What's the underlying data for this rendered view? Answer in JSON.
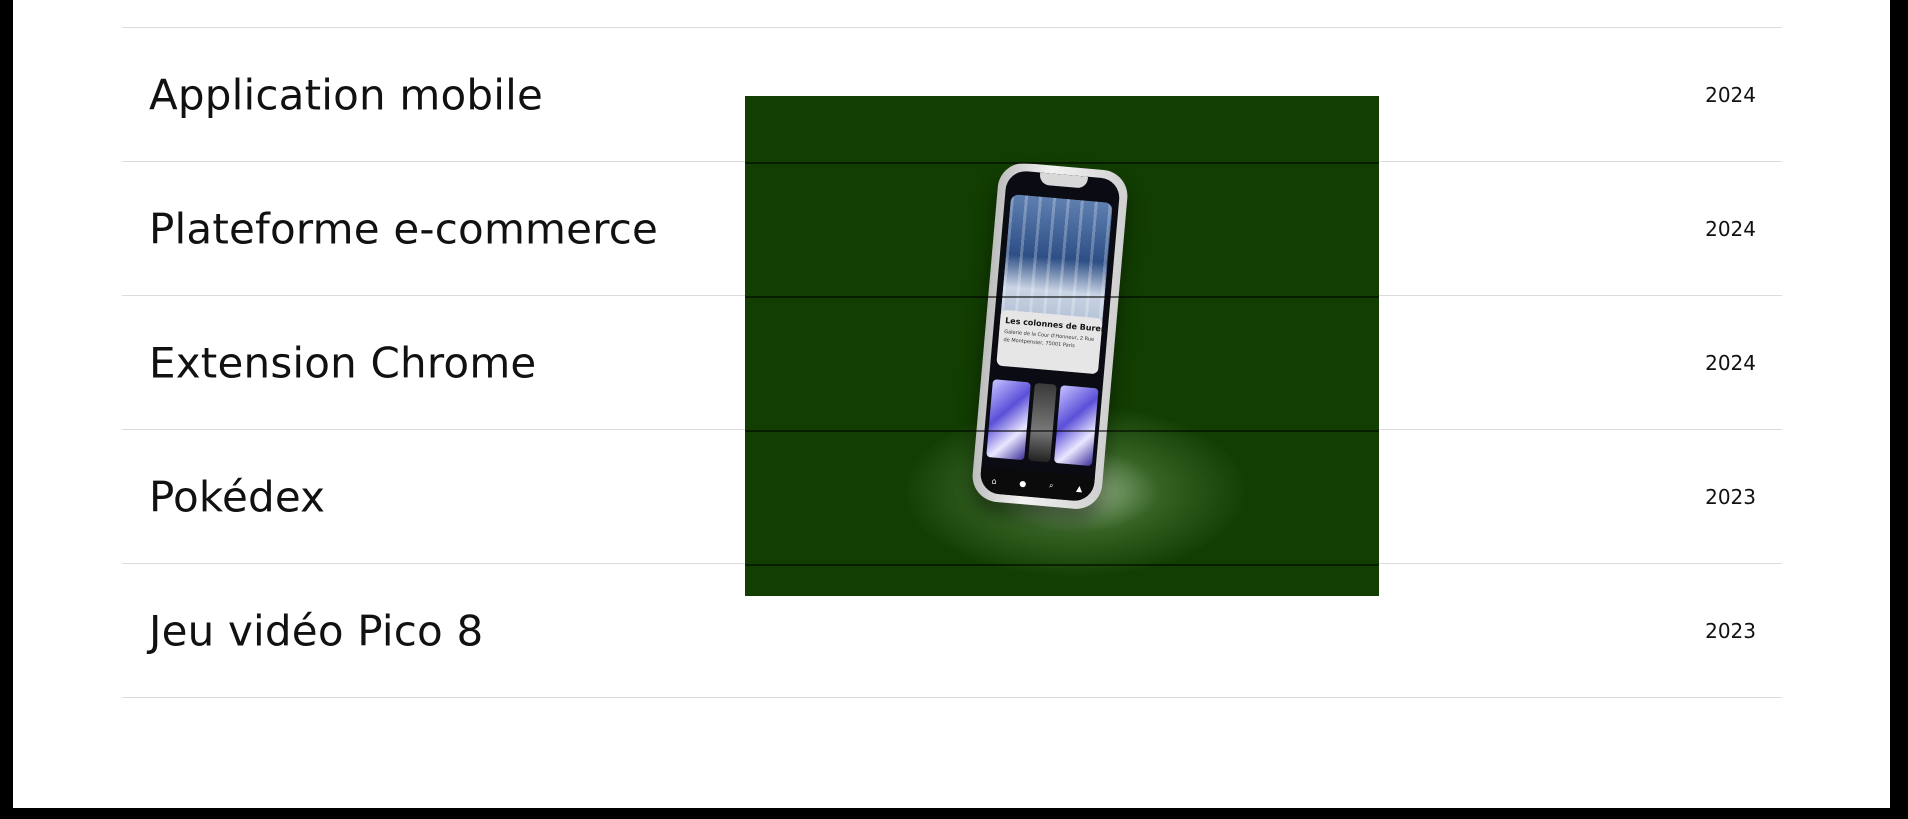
{
  "projects": [
    {
      "title": "Application mobile",
      "year": "2024"
    },
    {
      "title": "Plateforme e-commerce",
      "year": "2024"
    },
    {
      "title": "Extension Chrome",
      "year": "2024"
    },
    {
      "title": "Pokédex",
      "year": "2023"
    },
    {
      "title": "Jeu vidéo Pico 8",
      "year": "2023"
    }
  ],
  "preview": {
    "background_color": "#123e02",
    "app_card_title": "Les colonnes de Buren",
    "app_card_text": "Galerie de la Cour d'Honneur, 2 Rue de Montpensier, 75001 Paris",
    "tabbar_icons": [
      "home-icon",
      "map-pin-icon",
      "search-icon",
      "user-icon"
    ]
  }
}
